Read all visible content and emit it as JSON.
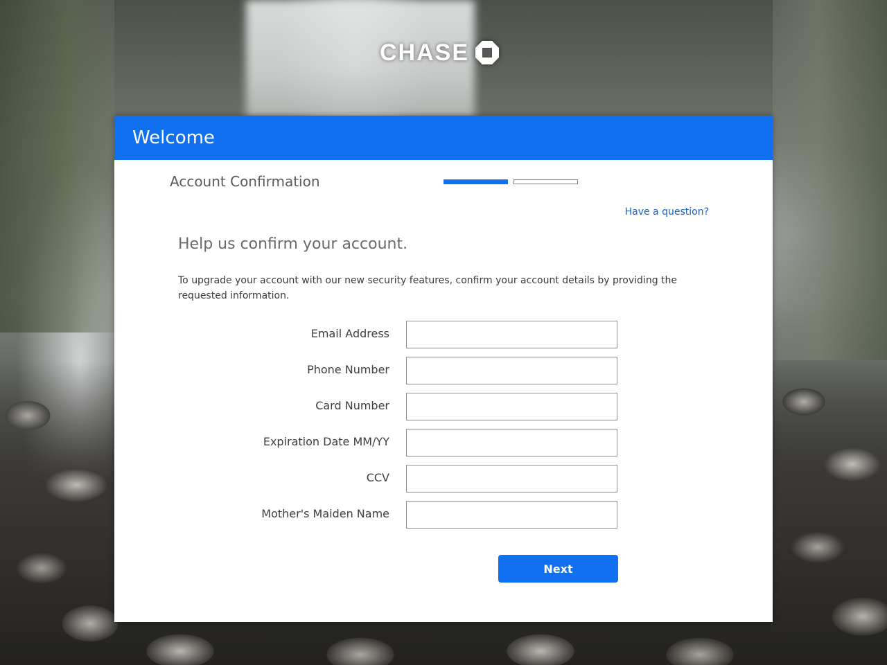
{
  "brand": {
    "name": "CHASE",
    "logo_icon": "chase-octagon-icon"
  },
  "header": {
    "title": "Welcome"
  },
  "step": {
    "title": "Account Confirmation",
    "current": 1,
    "total": 2
  },
  "help_link": "Have a question?",
  "form": {
    "heading": "Help us confirm your account.",
    "intro": "To upgrade your account with our new security features, confirm your account details by providing the requested information.",
    "fields": [
      {
        "label": "Email Address",
        "value": ""
      },
      {
        "label": "Phone Number",
        "value": ""
      },
      {
        "label": "Card Number",
        "value": ""
      },
      {
        "label": "Expiration Date MM/YY",
        "value": ""
      },
      {
        "label": "CCV",
        "value": ""
      },
      {
        "label": "Mother's Maiden Name",
        "value": ""
      }
    ],
    "submit_label": "Next"
  },
  "colors": {
    "accent": "#1170f0",
    "link": "#1a63c1"
  }
}
